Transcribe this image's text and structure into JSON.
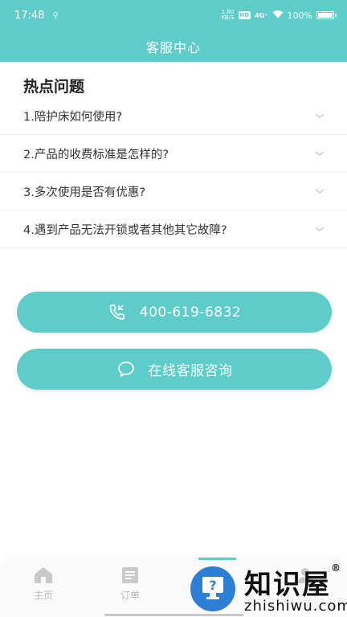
{
  "status_bar": {
    "time": "17:48",
    "net_speed_top": "1.60",
    "net_speed_bottom": "KB/S",
    "hd": "HD",
    "signal": "4G⁺",
    "battery": "100%"
  },
  "header": {
    "title": "客服中心"
  },
  "faq": {
    "heading": "热点问题",
    "items": [
      {
        "question": "1.陪护床如何使用?"
      },
      {
        "question": "2.产品的收费标准是怎样的?"
      },
      {
        "question": "3.多次使用是否有优惠?"
      },
      {
        "question": "4.遇到产品无法开锁或者其他其它故障?"
      }
    ]
  },
  "actions": {
    "phone": "400-619-6832",
    "chat": "在线客服咨询"
  },
  "tabbar": {
    "home": "主页",
    "order": "订单"
  },
  "watermark": {
    "title": "知识屋",
    "registered": "®",
    "domain": "zhishiwu.com"
  },
  "colors": {
    "accent": "#5ecdc9",
    "watermark_blue": "#2c7fd4"
  },
  "icons": {
    "chevron": "chevron-down-icon",
    "phone": "phone-call-icon",
    "chat": "chat-bubble-icon",
    "home": "home-icon",
    "order": "order-list-icon",
    "profile": "user-icon"
  }
}
